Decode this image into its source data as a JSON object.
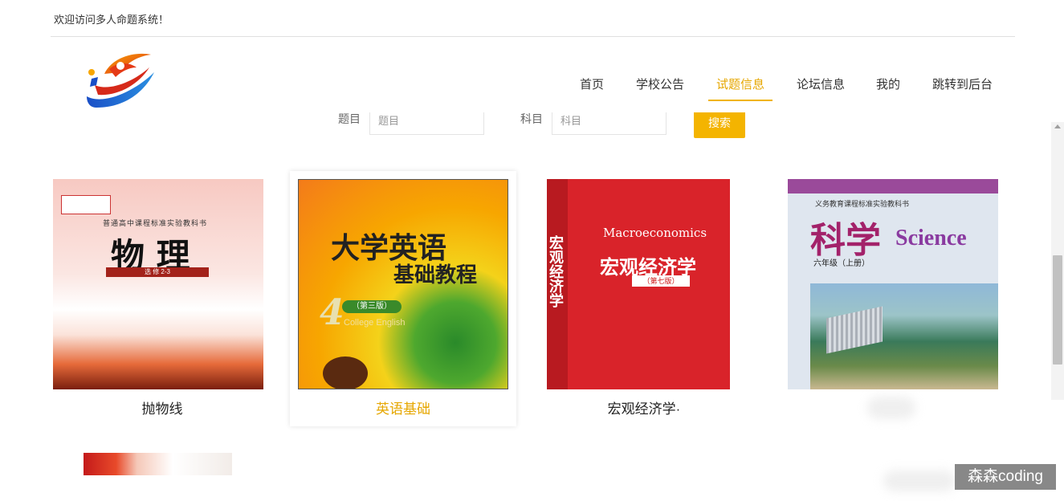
{
  "header": {
    "welcome": "欢迎访问多人命题系统！"
  },
  "nav": {
    "items": [
      {
        "label": "首页"
      },
      {
        "label": "学校公告"
      },
      {
        "label": "试题信息"
      },
      {
        "label": "论坛信息"
      },
      {
        "label": "我的"
      },
      {
        "label": "跳转到后台"
      }
    ],
    "active_index": 2
  },
  "search": {
    "title_label": "题目",
    "title_placeholder": "题目",
    "subject_label": "科目",
    "subject_placeholder": "科目",
    "button_label": "搜索"
  },
  "cards": [
    {
      "caption": "抛物线",
      "cover": {
        "title": "物 理",
        "subtitle": "选 修 2-3",
        "series": "普通高中课程标准实验教科书"
      }
    },
    {
      "caption": "英语基础",
      "cover": {
        "title": "大学英语",
        "subtitle": "基础教程",
        "series": "College English",
        "badge": "（第三版）",
        "number": "4"
      }
    },
    {
      "caption": "宏观经济学·",
      "cover": {
        "title": "宏观经济学",
        "english": "Macroeconomics",
        "edition": "（第七版）",
        "spine": "宏观经济学"
      }
    },
    {
      "caption": "",
      "cover": {
        "title": "科学",
        "english": "Science",
        "grade": "六年级（上册）",
        "series": "义务教育课程标准实验教科书"
      }
    }
  ],
  "watermark": "森森coding",
  "colors": {
    "accent": "#f4b400",
    "active_text": "#e6a700"
  }
}
